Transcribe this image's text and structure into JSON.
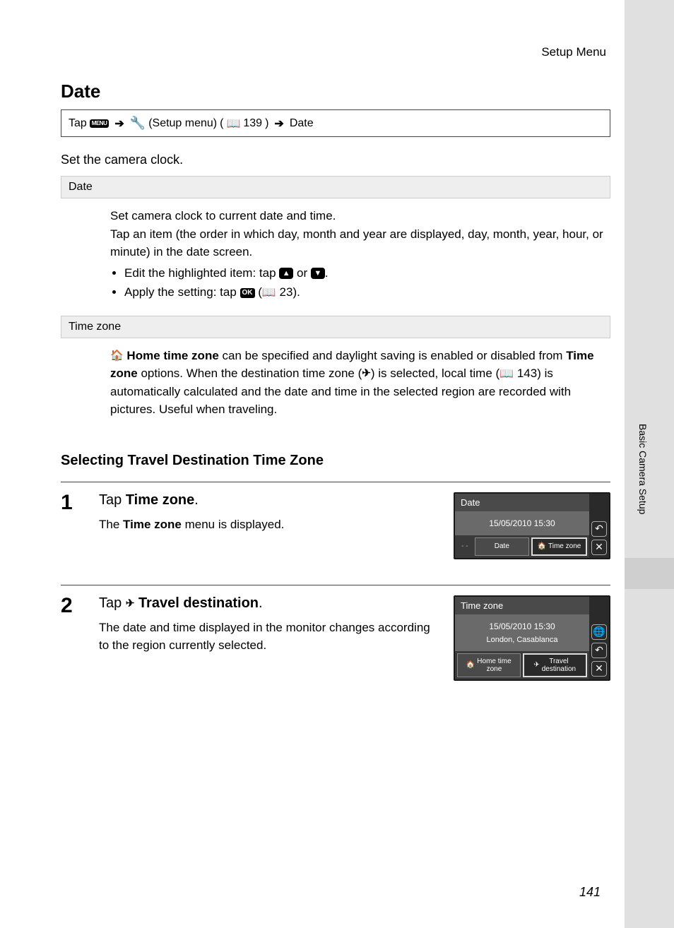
{
  "header": {
    "section": "Setup Menu"
  },
  "title": "Date",
  "nav": {
    "tap": "Tap",
    "menu_icon": "MENU",
    "setup_label": "(Setup menu)",
    "ref1": "139",
    "target": "Date"
  },
  "intro": "Set the camera clock.",
  "date_section": {
    "label": "Date",
    "p1": "Set camera clock to current date and time.",
    "p2": "Tap an item (the order in which day, month and year are displayed, day, month, year, hour, or minute) in the date screen.",
    "bullet1_a": "Edit the highlighted item: tap ",
    "bullet1_b": " or ",
    "bullet2_a": "Apply the setting: tap ",
    "bullet2_ref": "23"
  },
  "tz_section": {
    "label": "Time zone",
    "b1": "Home time zone",
    "t1": " can be specified and daylight saving is enabled or disabled from ",
    "b2": "Time zone",
    "t2": " options. When the destination time zone (",
    "t3": ") is selected, local time (",
    "ref": "143",
    "t4": ") is automatically calculated and the date and time in the selected region are recorded with pictures. Useful when traveling."
  },
  "h2": "Selecting Travel Destination Time Zone",
  "step1": {
    "num": "1",
    "title_a": "Tap ",
    "title_b": "Time zone",
    "title_c": ".",
    "body_a": "The ",
    "body_b": "Time zone",
    "body_c": " menu is displayed.",
    "screen": {
      "title": "Date",
      "datetime": "15/05/2010 15:30",
      "tab_dash": "- -",
      "tab1": "Date",
      "tab2": "Time zone"
    }
  },
  "step2": {
    "num": "2",
    "title_a": "Tap ",
    "title_b": " Travel destination",
    "title_c": ".",
    "body": "The date and time displayed in the monitor changes according to the region currently selected.",
    "screen": {
      "title": "Time zone",
      "datetime": "15/05/2010 15:30",
      "location": "London, Casablanca",
      "tab1a": "Home time",
      "tab1b": "zone",
      "tab2a": "Travel",
      "tab2b": "destination"
    }
  },
  "side_label": "Basic Camera Setup",
  "page_number": "141"
}
